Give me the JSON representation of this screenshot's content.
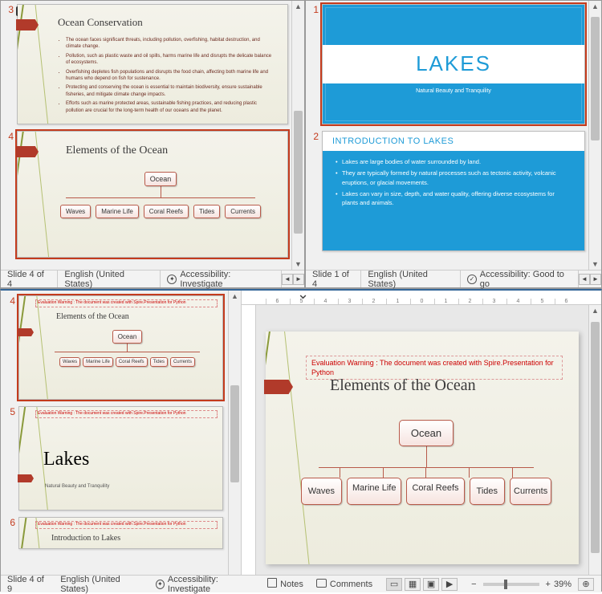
{
  "top_left": {
    "status_slide": "Slide 4 of 4",
    "language": "English (United States)",
    "accessibility": "Accessibility: Investigate",
    "slides": {
      "s3": {
        "num": "3",
        "title": "Ocean Conservation",
        "bullets": [
          "The ocean faces significant threats, including pollution, overfishing, habitat destruction, and climate change.",
          "Pollution, such as plastic waste and oil spills, harms marine life and disrupts the delicate balance of ecosystems.",
          "Overfishing depletes fish populations and disrupts the food chain, affecting both marine life and humans who depend on fish for sustenance.",
          "Protecting and conserving the ocean is essential to maintain biodiversity, ensure sustainable fisheries, and mitigate climate change impacts.",
          "Efforts such as marine protected areas, sustainable fishing practices, and reducing plastic pollution are crucial for the long-term health of our oceans and the planet."
        ]
      },
      "s4": {
        "num": "4",
        "title": "Elements of the Ocean",
        "root": "Ocean",
        "children": [
          "Waves",
          "Marine Life",
          "Coral Reefs",
          "Tides",
          "Currents"
        ]
      }
    }
  },
  "top_right": {
    "status_slide": "Slide 1 of 4",
    "language": "English (United States)",
    "accessibility": "Accessibility: Good to go",
    "slides": {
      "s1": {
        "num": "1",
        "title": "LAKES",
        "subtitle": "Natural Beauty and Tranquility"
      },
      "s2": {
        "num": "2",
        "title": "INTRODUCTION TO LAKES",
        "bullets": [
          "Lakes are large bodies of water surrounded by land.",
          "They are typically formed by natural processes such as tectonic activity, volcanic eruptions, or glacial movements.",
          "Lakes can vary in size, depth, and water quality, offering diverse ecosystems for plants and animals."
        ]
      }
    }
  },
  "bottom": {
    "status_slide": "Slide 4 of 9",
    "language": "English (United States)",
    "accessibility": "Accessibility: Investigate",
    "notes_label": "Notes",
    "comments_label": "Comments",
    "zoom": "39%",
    "warning": "Evaluation Warning : The document was created with Spire.Presentation for Python",
    "warning_short": "Evaluation Warning : The document was created with Spire.Presentation for Python",
    "thumbs": {
      "s4": {
        "num": "4",
        "title": "Elements of the Ocean",
        "root": "Ocean",
        "children": [
          "Waves",
          "Marine Life",
          "Coral Reefs",
          "Tides",
          "Currents"
        ]
      },
      "s5": {
        "num": "5",
        "title": "Lakes",
        "subtitle": "Natural Beauty and Tranquility"
      },
      "s6": {
        "num": "6",
        "title": "Introduction to Lakes"
      }
    },
    "main": {
      "title": "Elements of the Ocean",
      "root": "Ocean",
      "children": [
        "Waves",
        "Marine Life",
        "Coral Reefs",
        "Tides",
        "Currents"
      ]
    },
    "ruler": [
      "6",
      "5",
      "4",
      "3",
      "2",
      "1",
      "0",
      "1",
      "2",
      "3",
      "4",
      "5",
      "6"
    ]
  }
}
